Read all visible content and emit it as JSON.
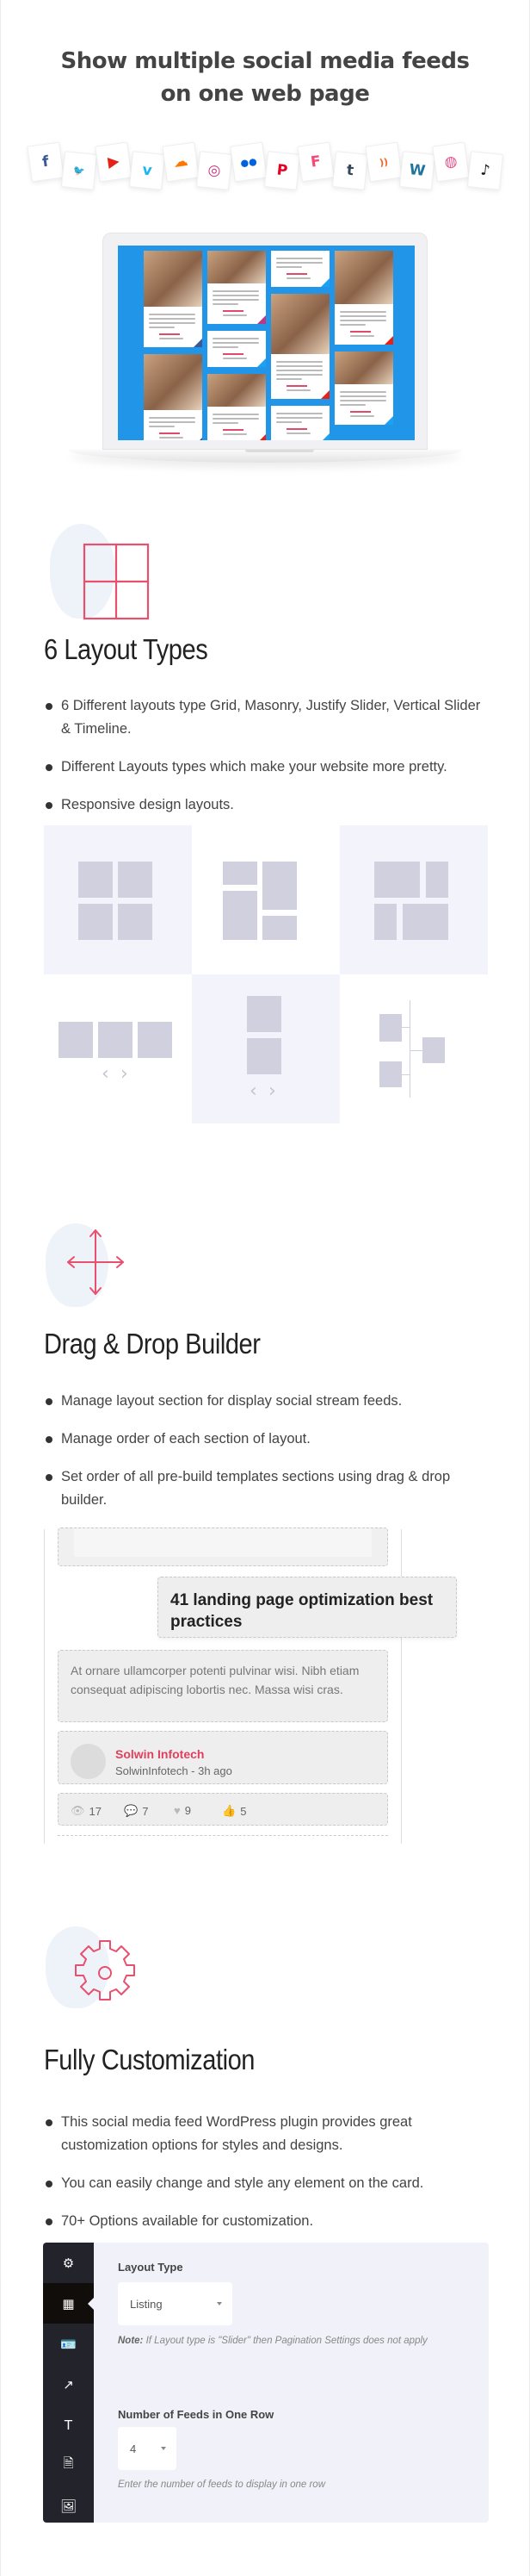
{
  "hero": {
    "title_line1": "Show multiple social media feeds",
    "title_line2": "on one web page",
    "social_icons": [
      {
        "name": "facebook-icon",
        "glyph": "f",
        "color": "#3b5998"
      },
      {
        "name": "twitter-icon",
        "glyph": "🐦",
        "color": "#1da1f2"
      },
      {
        "name": "youtube-icon",
        "glyph": "▶",
        "color": "#e62117"
      },
      {
        "name": "vimeo-icon",
        "glyph": "v",
        "color": "#1ab7ea"
      },
      {
        "name": "soundcloud-icon",
        "glyph": "☁",
        "color": "#ff7700"
      },
      {
        "name": "instagram-icon",
        "glyph": "◎",
        "color": "#c13584"
      },
      {
        "name": "flickr-icon",
        "glyph": "●●",
        "color": "#0063dc"
      },
      {
        "name": "pinterest-icon",
        "glyph": "P",
        "color": "#e60023"
      },
      {
        "name": "foursquare-icon",
        "glyph": "F",
        "color": "#f94877"
      },
      {
        "name": "tumblr-icon",
        "glyph": "t",
        "color": "#35465c"
      },
      {
        "name": "rss-icon",
        "glyph": "))",
        "color": "#f26522"
      },
      {
        "name": "wordpress-icon",
        "glyph": "W",
        "color": "#21759b"
      },
      {
        "name": "dribbble-icon",
        "glyph": "◍",
        "color": "#ea4c89"
      },
      {
        "name": "tiktok-icon",
        "glyph": "♪",
        "color": "#111111"
      }
    ],
    "screen_color": "#2196e8"
  },
  "layout_section": {
    "title": "6 Layout Types",
    "bullets": [
      "6 Different layouts type Grid, Masonry, Justify Slider, Vertical Slider & Timeline.",
      "Different Layouts types which make your website more pretty.",
      "Responsive design layouts."
    ],
    "tiles": [
      "grid",
      "masonry",
      "justify",
      "horizontal-slider",
      "vertical-slider",
      "timeline"
    ]
  },
  "drag_section": {
    "title": "Drag & Drop Builder",
    "bullets": [
      "Manage layout section for display social stream feeds.",
      "Manage order of each section of layout.",
      "Set order of all pre-build templates sections using drag & drop builder."
    ],
    "mock": {
      "dragged_title": "41 landing page optimization best practices",
      "body_text": "At ornare ullamcorper potenti pulvinar wisi. Nibh etiam consequat adipiscing lobortis nec. Massa wisi cras.",
      "author_name": "Solwin Infotech",
      "author_meta": "SolwinInfotech - 3h ago",
      "stats": {
        "views": "17",
        "comments": "7",
        "likes": "9",
        "thumbs": "5"
      }
    }
  },
  "custom_section": {
    "title": "Fully Customization",
    "bullets": [
      "This social media feed WordPress plugin provides great customization options for styles and designs.",
      "You can easily change and style any element on the card.",
      "70+ Options available for customization."
    ],
    "panel": {
      "sidebar_icons": [
        "gear-icon",
        "layout-icon",
        "id-card-icon",
        "share-icon",
        "text-width-icon",
        "document-icon",
        "images-icon"
      ],
      "active_sidebar_index": 1,
      "layout_type_label": "Layout Type",
      "layout_type_value": "Listing",
      "note_label": "Note:",
      "note_text": "If Layout type is \"Slider\" then Pagination Settings does not apply",
      "feeds_row_label": "Number of Feeds in One Row",
      "feeds_row_value": "4",
      "feeds_row_help": "Enter the number of feeds to display in one row"
    }
  },
  "colors": {
    "accent_pink": "#e8506e",
    "author_red": "#e0405f",
    "tile_bg": "#f3f3fb",
    "tile_block": "#d0d0de",
    "panel_bg": "#f1f2f9",
    "sidebar_bg": "#23242b"
  }
}
